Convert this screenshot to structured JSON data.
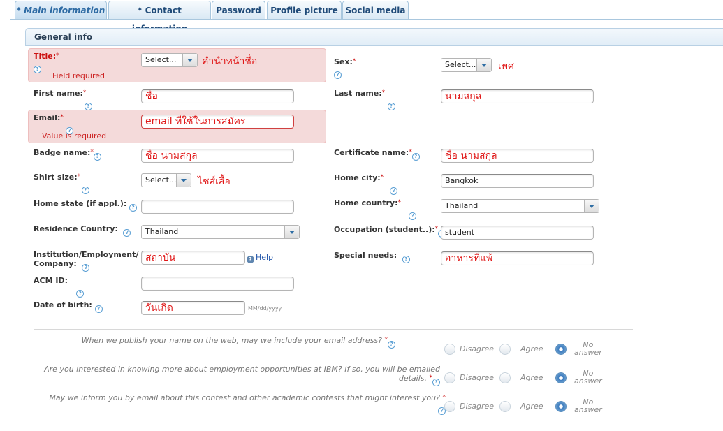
{
  "tabs": [
    {
      "label": "* Main information",
      "active": true
    },
    {
      "label": "* Contact information"
    },
    {
      "label": "Password"
    },
    {
      "label": "Profile picture"
    },
    {
      "label": "Social media"
    }
  ],
  "section_title": "General info",
  "help_glyph": "?",
  "required_mark": "*",
  "fields": {
    "title": {
      "label": "Title:",
      "value": "Select...",
      "note": "คำนำหน้าชื่อ",
      "error": "Field required"
    },
    "sex": {
      "label": "Sex:",
      "value": "Select...",
      "note": "เพศ"
    },
    "first_name": {
      "label": "First name:",
      "value": "ชื่อ"
    },
    "last_name": {
      "label": "Last name:",
      "value": "นามสกุล"
    },
    "email": {
      "label": "Email:",
      "value": "email ที่ใช้ในการสมัคร",
      "error": "Value is required"
    },
    "badge_name": {
      "label": "Badge name:",
      "value": "ชื่อ นามสกุล"
    },
    "certificate_name": {
      "label": "Certificate name:",
      "value": "ชื่อ นามสกุล"
    },
    "shirt_size": {
      "label": "Shirt size:",
      "value": "Select...",
      "note": "ไซส์เสื้อ"
    },
    "home_city": {
      "label": "Home city:",
      "value": "Bangkok"
    },
    "home_state": {
      "label": "Home state (if appl.):",
      "value": ""
    },
    "home_country": {
      "label": "Home country:",
      "value": "Thailand"
    },
    "residence_country": {
      "label": "Residence Country:",
      "value": "Thailand"
    },
    "occupation": {
      "label": "Occupation (student..):",
      "value": "student"
    },
    "institution": {
      "label_line1": "Institution/Employment/",
      "label_line2": "Company:",
      "value": "สถาบัน",
      "help": "Help"
    },
    "special_needs": {
      "label": "Special needs:",
      "value": "อาหารที่แพ้"
    },
    "acm_id": {
      "label": "ACM ID:",
      "value": ""
    },
    "dob": {
      "label": "Date of birth:",
      "value": "วันเกิด",
      "format_hint": "MM/dd/yyyy"
    }
  },
  "radio_labels": {
    "disagree": "Disagree",
    "agree": "Agree",
    "no_line1": "No",
    "no_line2": "answer"
  },
  "questions": [
    {
      "line1": "When we publish your name on the web, may we include your email address?",
      "line2": "",
      "selected": "no"
    },
    {
      "line1": "Are you interested in knowing more about employment opportunities at IBM? If so, you will be emailed",
      "line2": "details.",
      "selected": "no"
    },
    {
      "line1": "May we inform you by email about this contest and other academic contests that might interest you?",
      "line2": "",
      "selected": "no"
    }
  ],
  "colors": {
    "required": "#cc1111",
    "error_bg": "#f4dada",
    "tab_text": "#1f4a78",
    "annotation": "#e01818",
    "link": "#2255aa"
  }
}
